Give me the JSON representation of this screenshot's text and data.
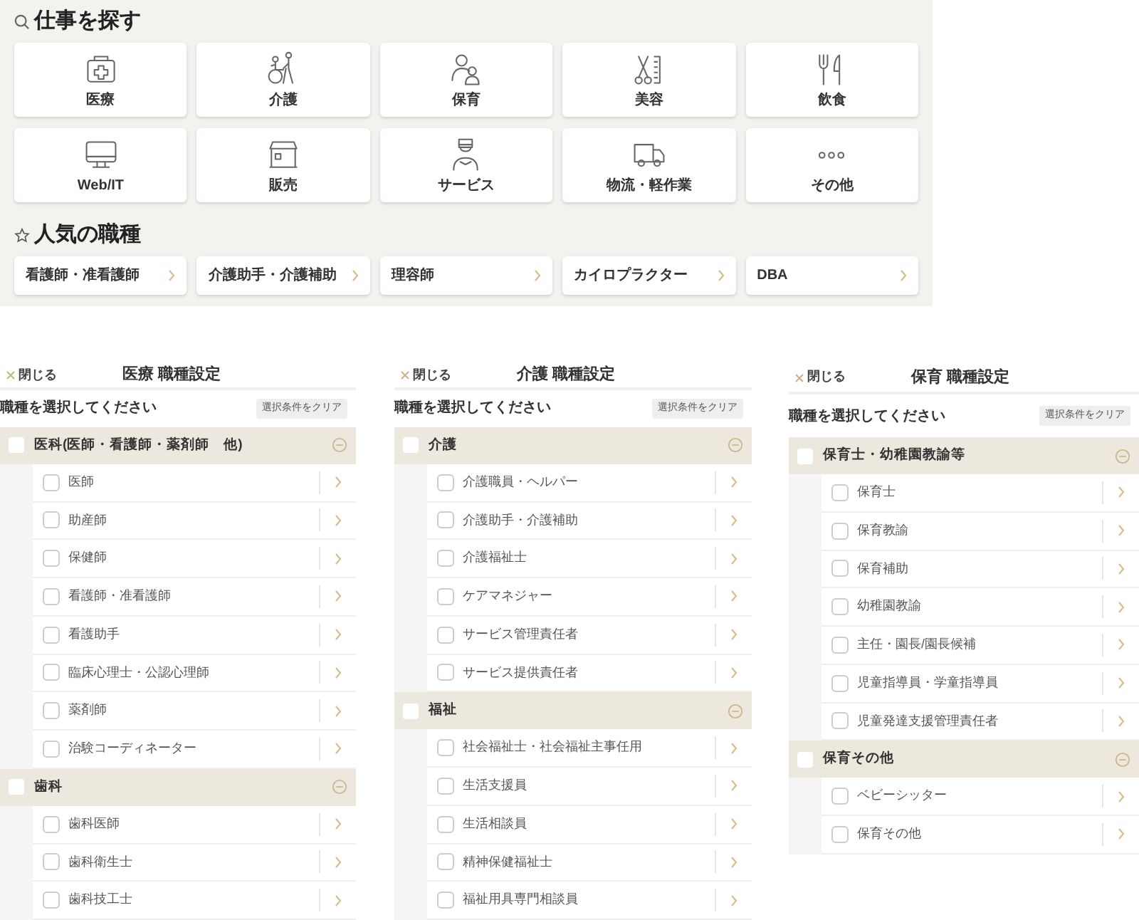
{
  "search_section": {
    "title": "仕事を探す",
    "categories": [
      {
        "label": "医療"
      },
      {
        "label": "介護"
      },
      {
        "label": "保育"
      },
      {
        "label": "美容"
      },
      {
        "label": "飲食"
      },
      {
        "label": "Web/IT"
      },
      {
        "label": "販売"
      },
      {
        "label": "サービス"
      },
      {
        "label": "物流・軽作業"
      },
      {
        "label": "その他"
      }
    ]
  },
  "popular_section": {
    "title": "人気の職種",
    "items": [
      {
        "label": "看護師・准看護師"
      },
      {
        "label": "介護助手・介護補助"
      },
      {
        "label": "理容師"
      },
      {
        "label": "カイロプラクター"
      },
      {
        "label": "DBA"
      }
    ]
  },
  "panels": [
    {
      "close_label": "閉じる",
      "title": "医療 職種設定",
      "prompt": "職種を選択してください",
      "clear_label": "選択条件をクリア",
      "groups": [
        {
          "label": "医科(医師・看護師・薬剤師　他)",
          "checked": false,
          "expanded": true,
          "items": [
            {
              "label": "医師",
              "checked": false
            },
            {
              "label": "助産師",
              "checked": false
            },
            {
              "label": "保健師",
              "checked": false
            },
            {
              "label": "看護師・准看護師",
              "checked": false
            },
            {
              "label": "看護助手",
              "checked": false
            },
            {
              "label": "臨床心理士・公認心理師",
              "checked": false
            },
            {
              "label": "薬剤師",
              "checked": false
            },
            {
              "label": "治験コーディネーター",
              "checked": false
            }
          ]
        },
        {
          "label": "歯科",
          "checked": false,
          "expanded": true,
          "items": [
            {
              "label": "歯科医師",
              "checked": false
            },
            {
              "label": "歯科衛生士",
              "checked": false
            },
            {
              "label": "歯科技工士",
              "checked": false
            }
          ]
        }
      ]
    },
    {
      "close_label": "閉じる",
      "title": "介護 職種設定",
      "prompt": "職種を選択してください",
      "clear_label": "選択条件をクリア",
      "groups": [
        {
          "label": "介護",
          "checked": false,
          "expanded": true,
          "items": [
            {
              "label": "介護職員・ヘルパー",
              "checked": false
            },
            {
              "label": "介護助手・介護補助",
              "checked": false
            },
            {
              "label": "介護福祉士",
              "checked": false
            },
            {
              "label": "ケアマネジャー",
              "checked": false
            },
            {
              "label": "サービス管理責任者",
              "checked": false
            },
            {
              "label": "サービス提供責任者",
              "checked": false
            }
          ]
        },
        {
          "label": "福祉",
          "checked": false,
          "expanded": true,
          "items": [
            {
              "label": "社会福祉士・社会福祉主事任用",
              "checked": false
            },
            {
              "label": "生活支援員",
              "checked": false
            },
            {
              "label": "生活相談員",
              "checked": false
            },
            {
              "label": "精神保健福祉士",
              "checked": false
            },
            {
              "label": "福祉用具専門相談員",
              "checked": false
            }
          ]
        }
      ]
    },
    {
      "close_label": "閉じる",
      "title": "保育 職種設定",
      "prompt": "職種を選択してください",
      "clear_label": "選択条件をクリア",
      "groups": [
        {
          "label": "保育士・幼稚園教諭等",
          "checked": false,
          "expanded": true,
          "items": [
            {
              "label": "保育士",
              "checked": false
            },
            {
              "label": "保育教諭",
              "checked": false
            },
            {
              "label": "保育補助",
              "checked": false
            },
            {
              "label": "幼稚園教諭",
              "checked": false
            },
            {
              "label": "主任・園長/園長候補",
              "checked": false
            },
            {
              "label": "児童指導員・学童指導員",
              "checked": false
            },
            {
              "label": "児童発達支援管理責任者",
              "checked": false
            }
          ]
        },
        {
          "label": "保育その他",
          "checked": false,
          "expanded": true,
          "items": [
            {
              "label": "ベビーシッター",
              "checked": false
            },
            {
              "label": "保育その他",
              "checked": false
            }
          ]
        }
      ]
    }
  ]
}
